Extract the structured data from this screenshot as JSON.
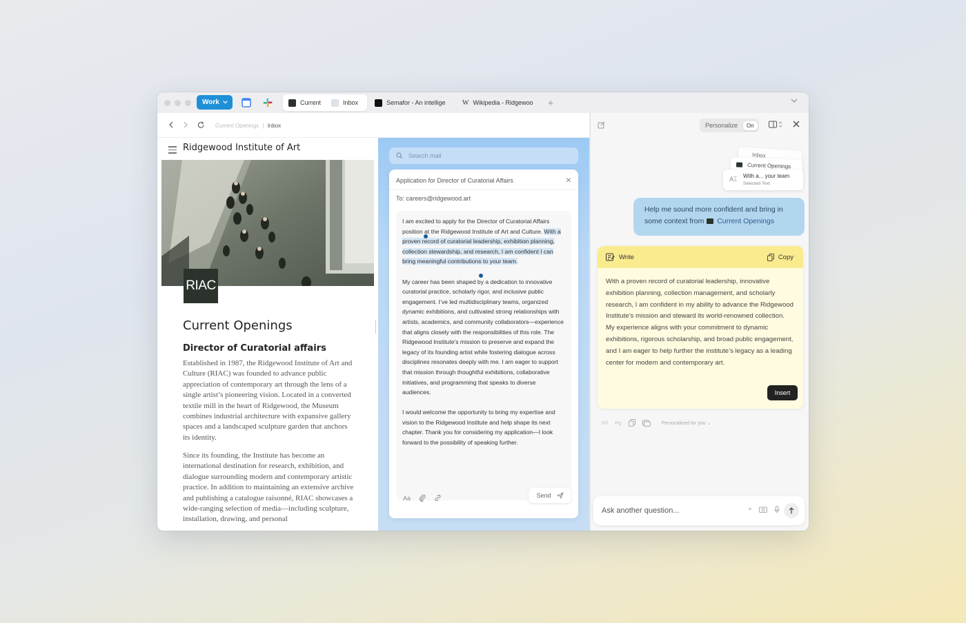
{
  "tabbar": {
    "space_label": "Work",
    "tabs": [
      {
        "label": "Current"
      },
      {
        "label": "Inbox"
      },
      {
        "label": "Semafor - An intellige"
      },
      {
        "label": "Wikipedia - Ridgewoo"
      }
    ],
    "new_tab": "+"
  },
  "navbar": {
    "breadcrumb_1": "Current Openings",
    "breadcrumb_sep": "|",
    "breadcrumb_2": "Inbox"
  },
  "site": {
    "title": "Ridgewood Institute of Art",
    "logo_text": "RIAC",
    "heading": "Current Openings",
    "subheading": "Director of Curatorial affairs",
    "paragraph_1": "Established in 1987, the Ridgewood Institute of Art and Culture (RIAC) was founded to advance public appreciation of contemporary art through the lens of a single artist’s pioneering vision. Located in a converted textile mill in the heart of Ridgewood, the Museum combines industrial architecture with expansive gallery spaces and a landscaped sculpture garden that anchors its identity.",
    "paragraph_2": "Since its founding, the Institute has become an international destination for research, exhibition, and dialogue surrounding modern and contemporary artistic practice. In addition to maintaining an extensive archive and publishing a catalogue raisonné, RIAC showcases a wide-ranging selection of media—including sculpture, installation, drawing, and personal"
  },
  "mail": {
    "search_placeholder": "Search mail",
    "subject": "Application for Director of Curatorial Affairs",
    "to": "To: careers@ridgewood.art",
    "body_1_plain": "I am excited to apply for the Director of Curatorial Affairs position at the Ridgewood Institute of Art and Culture.",
    "body_1_selected": "With a proven record of curatorial leadership, exhibition planning, collection stewardship, and research, I am confident I can bring meaningful contributions to your team.",
    "body_2": "My career has been shaped by a dedication to innovative curatorial practice, scholarly rigor, and inclusive public engagement. I’ve led multidisciplinary teams, organized dynamic exhibitions, and cultivated strong relationships with artists, academics, and community collaborators—experience that aligns closely with the responsibilities of this role. The Ridgewood Institute’s mission to preserve and expand the legacy of its founding artist while fostering dialogue across disciplines resonates deeply with me. I am eager to support that mission through thoughtful exhibitions, collaborative initiatives, and programming that speaks to diverse audiences.",
    "body_3": "I would welcome the opportunity to bring my expertise and vision to the Ridgewood Institute and help shape its next chapter. Thank you for considering my application—I look forward to the possibility of speaking further.",
    "format_label": "Aa",
    "send_label": "Send"
  },
  "assistant": {
    "personalize_label": "Personalize",
    "personalize_state": "On",
    "context_cards": [
      {
        "label": "Inbox"
      },
      {
        "label": "Current Openings"
      },
      {
        "label": "With a... your team",
        "sub": "Selected Text"
      }
    ],
    "prompt_text": "Help me sound more confident and bring in some context from",
    "prompt_context": "Current Openings",
    "card_title": "Write",
    "copy_label": "Copy",
    "response": "With a proven record of curatorial leadership, innovative exhibition planning, collection management, and scholarly research, I am confident in my ability to advance the Ridgewood Institute’s mission and steward its world-renowned collection. My experience aligns with your commitment to dynamic exhibitions, rigorous scholarship, and broad public engagement, and I am eager to help further the institute’s legacy as a leading center for modern and contemporary art.",
    "insert_label": "Insert",
    "personalized_label": "Personalized for you",
    "ask_placeholder": "Ask another question..."
  },
  "colors": {
    "accent": "#1e90d8",
    "write_card_header": "#fbeb8f",
    "prompt_bubble": "#b3d6ef",
    "selection": "#d6e6f4"
  }
}
